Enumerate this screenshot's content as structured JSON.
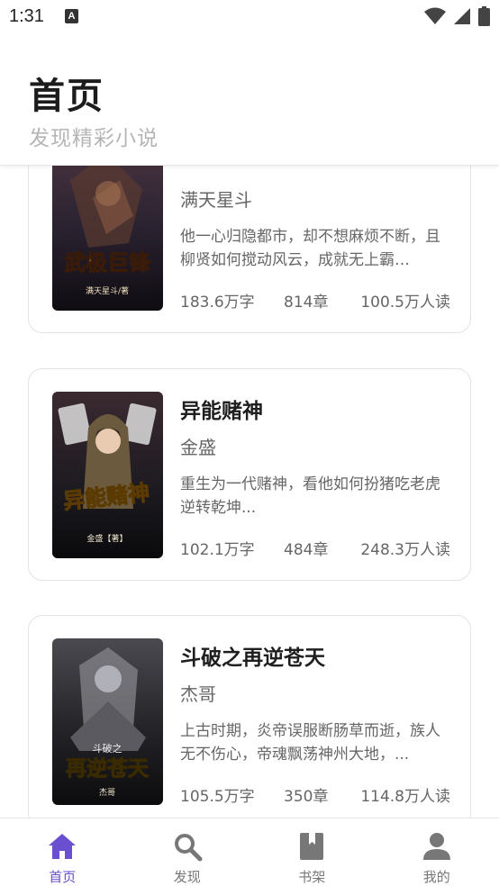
{
  "status_bar": {
    "time": "1:31",
    "notification_icon": "A"
  },
  "header": {
    "title": "首页",
    "subtitle": "发现精彩小说"
  },
  "books": [
    {
      "title": "",
      "author": "满天星斗",
      "description": "他一心归隐都市，却不想麻烦不断，且柳贤如何搅动风云，成就无上霸…",
      "words": "183.6万字",
      "chapters": "814章",
      "readers": "100.5万人读",
      "cover": {
        "title": "武极巨锋",
        "author": "满天星斗/著",
        "bg": "#2a2230",
        "accent": "#d9a640"
      }
    },
    {
      "title": "异能赌神",
      "author": "金盛",
      "description": "重生为一代赌神，看他如何扮猪吃老虎逆转乾坤...",
      "words": "102.1万字",
      "chapters": "484章",
      "readers": "248.3万人读",
      "cover": {
        "title": "异能赌神",
        "author": "金盛【著】",
        "bg": "#1c1a20",
        "accent": "#f2c230"
      }
    },
    {
      "title": "斗破之再逆苍天",
      "author": "杰哥",
      "description": "上古时期，炎帝误服断肠草而逝，族人无不伤心，帝魂飘荡神州大地，...",
      "words": "105.5万字",
      "chapters": "350章",
      "readers": "114.8万人读",
      "cover": {
        "title": "再逆苍天",
        "author": "杰哥",
        "bg": "#26262b",
        "accent": "#e8c060"
      }
    }
  ],
  "tabbar": [
    {
      "label": "首页",
      "icon": "home-icon",
      "active": true
    },
    {
      "label": "发现",
      "icon": "search-icon",
      "active": false
    },
    {
      "label": "书架",
      "icon": "book-icon",
      "active": false
    },
    {
      "label": "我的",
      "icon": "user-icon",
      "active": false
    }
  ],
  "colors": {
    "accent": "#6a4fd0",
    "text_secondary": "#666666",
    "subtitle": "#b5b5b5"
  }
}
